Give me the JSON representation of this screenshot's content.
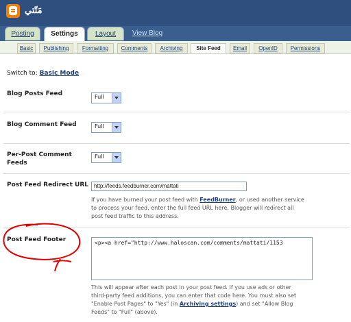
{
  "header": {
    "blog_title": "مَتّتي",
    "logo_icon": "blogger-logo-icon"
  },
  "main_tabs": [
    {
      "label": "Posting"
    },
    {
      "label": "Settings"
    },
    {
      "label": "Layout"
    },
    {
      "label": "View Blog"
    }
  ],
  "sub_tabs": [
    {
      "label": "Basic"
    },
    {
      "label": "Publishing"
    },
    {
      "label": "Formatting"
    },
    {
      "label": "Comments"
    },
    {
      "label": "Archiving"
    },
    {
      "label": "Site Feed"
    },
    {
      "label": "Email"
    },
    {
      "label": "OpenID"
    },
    {
      "label": "Permissions"
    }
  ],
  "active_sub_tab": "Site Feed",
  "switch_to": {
    "prefix": "Switch to:",
    "link": "Basic Mode"
  },
  "settings": {
    "blog_posts_feed": {
      "label": "Blog Posts Feed",
      "value": "Full"
    },
    "blog_comment_feed": {
      "label": "Blog Comment Feed",
      "value": "Full"
    },
    "per_post_comment_feeds": {
      "label_line1": "Per-Post Comment",
      "label_line2": "Feeds",
      "value": "Full"
    },
    "post_feed_redirect_url": {
      "label": "Post Feed Redirect URL",
      "value": "http://feeds.feedburner.com/mattati",
      "help_line1_a": "If you have burned your post feed with ",
      "help_link": "FeedBurner",
      "help_line1_b": ", or used another service",
      "help_line2": "to process your feed, enter the full feed URL here. Blogger will redirect all",
      "help_line3": "post feed traffic to this address."
    },
    "post_feed_footer": {
      "label": "Post Feed Footer",
      "value": "<p><a href=\"http://www.haloscan.com/comments/mattati/1153",
      "help_line1": "This will appear after each post in your post feed. If you use ads or other",
      "help_line2": "third-party feed additions, you can enter that code here. You must also set",
      "help_line3_a": "\"Enable Post Pages\" to \"Yes\" (in ",
      "help_link": "Archiving settings",
      "help_line3_b": ") and set \"Allow Blog",
      "help_line4": "Feeds\" to \"Full\" (above)."
    }
  },
  "colors": {
    "header_bg": "#2f4f7f",
    "link": "#1b3f77",
    "annotation": "#e00000"
  }
}
